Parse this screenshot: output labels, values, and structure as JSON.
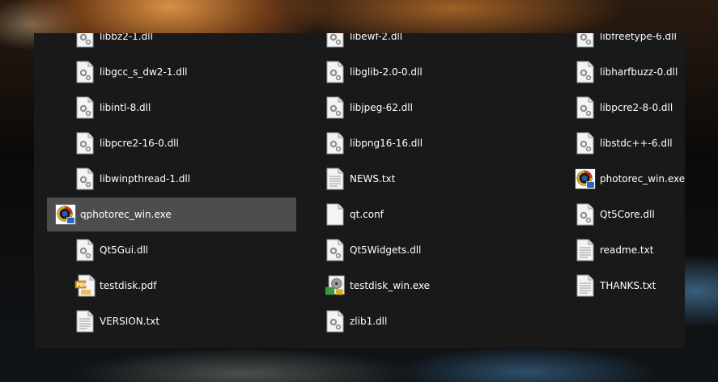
{
  "explorer": {
    "files": [
      {
        "name": "libbz2-1.dll",
        "icon": "dll-file-icon"
      },
      {
        "name": "libewf-2.dll",
        "icon": "dll-file-icon"
      },
      {
        "name": "libfreetype-6.dll",
        "icon": "dll-file-icon"
      },
      {
        "name": "libgcc_s_dw2-1.dll",
        "icon": "dll-file-icon"
      },
      {
        "name": "libglib-2.0-0.dll",
        "icon": "dll-file-icon"
      },
      {
        "name": "libharfbuzz-0.dll",
        "icon": "dll-file-icon"
      },
      {
        "name": "libintl-8.dll",
        "icon": "dll-file-icon"
      },
      {
        "name": "libjpeg-62.dll",
        "icon": "dll-file-icon"
      },
      {
        "name": "libpcre2-8-0.dll",
        "icon": "dll-file-icon"
      },
      {
        "name": "libpcre2-16-0.dll",
        "icon": "dll-file-icon"
      },
      {
        "name": "libpng16-16.dll",
        "icon": "dll-file-icon"
      },
      {
        "name": "libstdc++-6.dll",
        "icon": "dll-file-icon"
      },
      {
        "name": "libwinpthread-1.dll",
        "icon": "dll-file-icon"
      },
      {
        "name": "NEWS.txt",
        "icon": "text-file-icon"
      },
      {
        "name": "photorec_win.exe",
        "icon": "photorec-app-icon"
      },
      {
        "name": "qphotorec_win.exe",
        "icon": "photorec-app-icon"
      },
      {
        "name": "qt.conf",
        "icon": "blank-file-icon"
      },
      {
        "name": "Qt5Core.dll",
        "icon": "dll-file-icon"
      },
      {
        "name": "Qt5Gui.dll",
        "icon": "dll-file-icon"
      },
      {
        "name": "Qt5Widgets.dll",
        "icon": "dll-file-icon"
      },
      {
        "name": "readme.txt",
        "icon": "text-file-icon"
      },
      {
        "name": "testdisk.pdf",
        "icon": "pdf-file-icon"
      },
      {
        "name": "testdisk_win.exe",
        "icon": "testdisk-app-icon"
      },
      {
        "name": "THANKS.txt",
        "icon": "text-file-icon"
      },
      {
        "name": "VERSION.txt",
        "icon": "text-file-icon"
      },
      {
        "name": "zlib1.dll",
        "icon": "dll-file-icon"
      }
    ],
    "selected_file": "qphotorec_win.exe"
  }
}
